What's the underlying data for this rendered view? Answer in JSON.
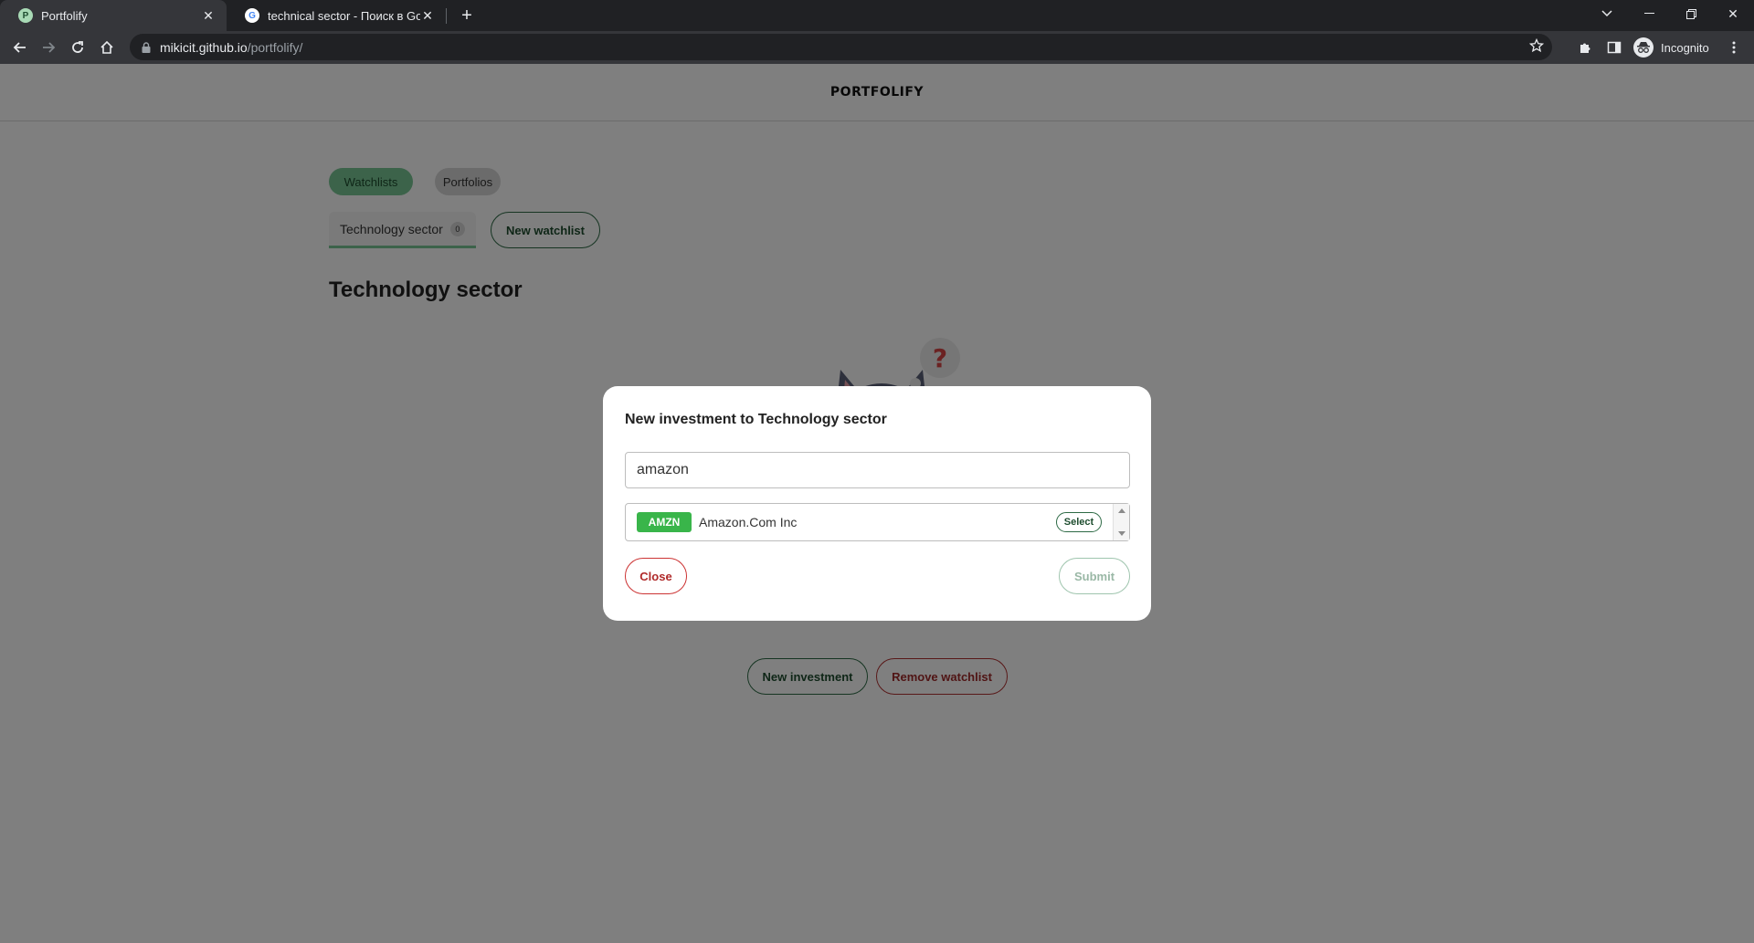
{
  "browser": {
    "tabs": [
      {
        "title": "Portfolify",
        "favicon_letter": "P",
        "active": true
      },
      {
        "title": "technical sector - Поиск в Googl",
        "favicon_letter": "G",
        "active": false
      }
    ],
    "url_host": "mikicit.github.io",
    "url_path": "/portfolify/",
    "profile_label": "Incognito"
  },
  "app": {
    "brand": "PORTFOLIFY",
    "nav": {
      "watchlists": "Watchlists",
      "portfolios": "Portfolios"
    },
    "watchlist_tab": {
      "label": "Technology sector",
      "count": "0"
    },
    "new_watchlist_label": "New watchlist",
    "page_title": "Technology sector",
    "new_investment_label": "New investment",
    "remove_watchlist_label": "Remove watchlist"
  },
  "modal": {
    "title": "New investment to Technology sector",
    "search_value": "amazon",
    "results": [
      {
        "ticker": "AMZN",
        "name": "Amazon.Com Inc",
        "action": "Select"
      }
    ],
    "close_label": "Close",
    "submit_label": "Submit"
  },
  "colors": {
    "accent_green": "#78c695",
    "ticker_green": "#39b54a",
    "danger_red": "#b02a2a"
  }
}
